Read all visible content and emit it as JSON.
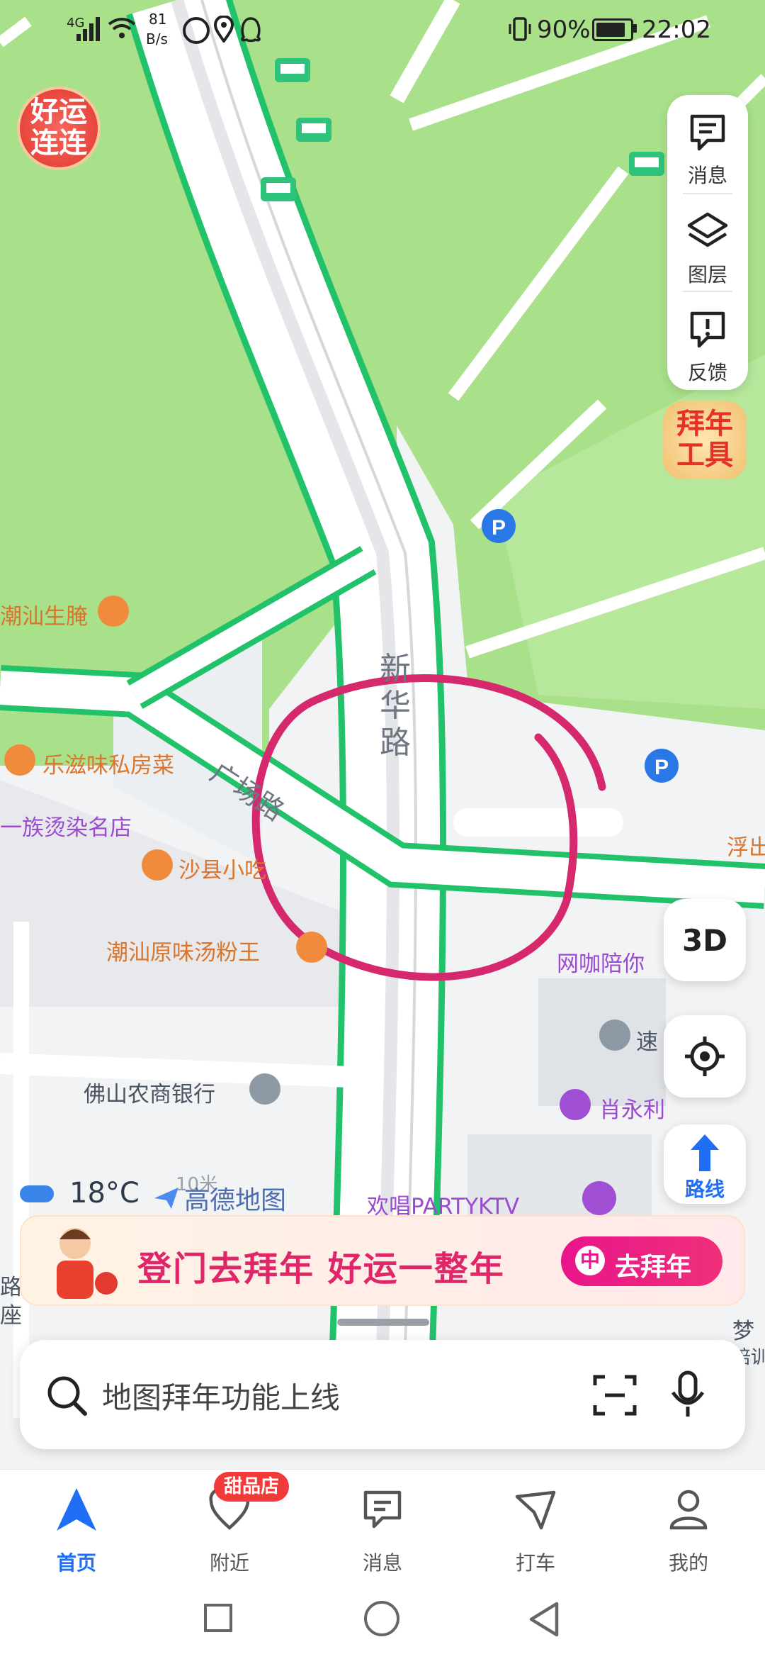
{
  "status_bar": {
    "network": "4G",
    "speed_value": "81",
    "speed_unit": "B/s",
    "battery": "90%",
    "time": "22:02"
  },
  "map": {
    "road_main": "新华路",
    "road_side": "广场路",
    "scale": "10米",
    "brand": "高德地图",
    "pois": {
      "chaoshan_shengyan": "潮汕生腌",
      "lezi_weisifangcai": "乐滋味私房菜",
      "zu_tangran": "一族烫染名店",
      "shaxian": "沙县小吃",
      "chaoshan_tangfen": "潮汕原味汤粉王",
      "wangka": "网咖陪你",
      "su": "速",
      "xiaoyongli": "肖永利",
      "foshan_bank": "佛山农商银行",
      "huanchang_ktv": "欢唱PARTYKTV",
      "fu": "浮出",
      "meng": "梦",
      "peixun": "培训",
      "lu": "路",
      "zuo": "座"
    },
    "promo_badge_left": "好运连连",
    "promo_badge_right": "拜年工具"
  },
  "right_panel": {
    "messages_label": "消息",
    "layers_label": "图层",
    "feedback_label": "反馈"
  },
  "controls": {
    "view_3d": "3D",
    "route_label": "路线"
  },
  "weather": {
    "temperature": "18°C"
  },
  "banner": {
    "text": "登门去拜年 好运一整年",
    "button": "去拜年"
  },
  "search": {
    "placeholder": "地图拜年功能上线"
  },
  "tabbar": {
    "badge": "甜品店",
    "tabs": [
      {
        "label": "首页",
        "icon": "navigate-icon"
      },
      {
        "label": "附近",
        "icon": "heart-icon"
      },
      {
        "label": "消息",
        "icon": "message-icon"
      },
      {
        "label": "打车",
        "icon": "taxi-icon"
      },
      {
        "label": "我的",
        "icon": "profile-icon"
      }
    ]
  },
  "colors": {
    "accent": "#1f6ef5",
    "park_green": "#a9e08a",
    "road_border": "#22c26b",
    "annotation": "#d6286c"
  }
}
